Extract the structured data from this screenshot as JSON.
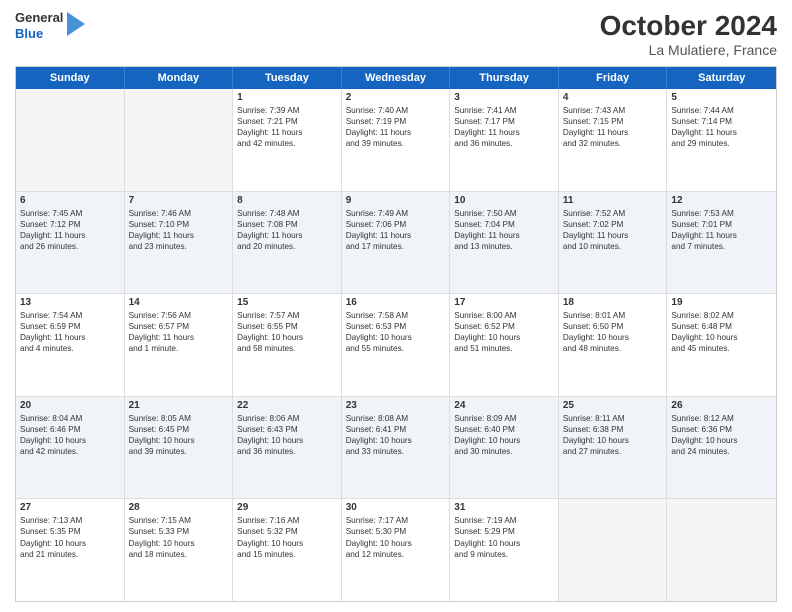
{
  "header": {
    "logo_general": "General",
    "logo_blue": "Blue",
    "title": "October 2024",
    "subtitle": "La Mulatiere, France"
  },
  "days_of_week": [
    "Sunday",
    "Monday",
    "Tuesday",
    "Wednesday",
    "Thursday",
    "Friday",
    "Saturday"
  ],
  "rows": [
    {
      "alt": false,
      "cells": [
        {
          "day": "",
          "empty": true,
          "lines": []
        },
        {
          "day": "",
          "empty": true,
          "lines": []
        },
        {
          "day": "1",
          "empty": false,
          "lines": [
            "Sunrise: 7:39 AM",
            "Sunset: 7:21 PM",
            "Daylight: 11 hours",
            "and 42 minutes."
          ]
        },
        {
          "day": "2",
          "empty": false,
          "lines": [
            "Sunrise: 7:40 AM",
            "Sunset: 7:19 PM",
            "Daylight: 11 hours",
            "and 39 minutes."
          ]
        },
        {
          "day": "3",
          "empty": false,
          "lines": [
            "Sunrise: 7:41 AM",
            "Sunset: 7:17 PM",
            "Daylight: 11 hours",
            "and 36 minutes."
          ]
        },
        {
          "day": "4",
          "empty": false,
          "lines": [
            "Sunrise: 7:43 AM",
            "Sunset: 7:15 PM",
            "Daylight: 11 hours",
            "and 32 minutes."
          ]
        },
        {
          "day": "5",
          "empty": false,
          "lines": [
            "Sunrise: 7:44 AM",
            "Sunset: 7:14 PM",
            "Daylight: 11 hours",
            "and 29 minutes."
          ]
        }
      ]
    },
    {
      "alt": true,
      "cells": [
        {
          "day": "6",
          "empty": false,
          "lines": [
            "Sunrise: 7:45 AM",
            "Sunset: 7:12 PM",
            "Daylight: 11 hours",
            "and 26 minutes."
          ]
        },
        {
          "day": "7",
          "empty": false,
          "lines": [
            "Sunrise: 7:46 AM",
            "Sunset: 7:10 PM",
            "Daylight: 11 hours",
            "and 23 minutes."
          ]
        },
        {
          "day": "8",
          "empty": false,
          "lines": [
            "Sunrise: 7:48 AM",
            "Sunset: 7:08 PM",
            "Daylight: 11 hours",
            "and 20 minutes."
          ]
        },
        {
          "day": "9",
          "empty": false,
          "lines": [
            "Sunrise: 7:49 AM",
            "Sunset: 7:06 PM",
            "Daylight: 11 hours",
            "and 17 minutes."
          ]
        },
        {
          "day": "10",
          "empty": false,
          "lines": [
            "Sunrise: 7:50 AM",
            "Sunset: 7:04 PM",
            "Daylight: 11 hours",
            "and 13 minutes."
          ]
        },
        {
          "day": "11",
          "empty": false,
          "lines": [
            "Sunrise: 7:52 AM",
            "Sunset: 7:02 PM",
            "Daylight: 11 hours",
            "and 10 minutes."
          ]
        },
        {
          "day": "12",
          "empty": false,
          "lines": [
            "Sunrise: 7:53 AM",
            "Sunset: 7:01 PM",
            "Daylight: 11 hours",
            "and 7 minutes."
          ]
        }
      ]
    },
    {
      "alt": false,
      "cells": [
        {
          "day": "13",
          "empty": false,
          "lines": [
            "Sunrise: 7:54 AM",
            "Sunset: 6:59 PM",
            "Daylight: 11 hours",
            "and 4 minutes."
          ]
        },
        {
          "day": "14",
          "empty": false,
          "lines": [
            "Sunrise: 7:56 AM",
            "Sunset: 6:57 PM",
            "Daylight: 11 hours",
            "and 1 minute."
          ]
        },
        {
          "day": "15",
          "empty": false,
          "lines": [
            "Sunrise: 7:57 AM",
            "Sunset: 6:55 PM",
            "Daylight: 10 hours",
            "and 58 minutes."
          ]
        },
        {
          "day": "16",
          "empty": false,
          "lines": [
            "Sunrise: 7:58 AM",
            "Sunset: 6:53 PM",
            "Daylight: 10 hours",
            "and 55 minutes."
          ]
        },
        {
          "day": "17",
          "empty": false,
          "lines": [
            "Sunrise: 8:00 AM",
            "Sunset: 6:52 PM",
            "Daylight: 10 hours",
            "and 51 minutes."
          ]
        },
        {
          "day": "18",
          "empty": false,
          "lines": [
            "Sunrise: 8:01 AM",
            "Sunset: 6:50 PM",
            "Daylight: 10 hours",
            "and 48 minutes."
          ]
        },
        {
          "day": "19",
          "empty": false,
          "lines": [
            "Sunrise: 8:02 AM",
            "Sunset: 6:48 PM",
            "Daylight: 10 hours",
            "and 45 minutes."
          ]
        }
      ]
    },
    {
      "alt": true,
      "cells": [
        {
          "day": "20",
          "empty": false,
          "lines": [
            "Sunrise: 8:04 AM",
            "Sunset: 6:46 PM",
            "Daylight: 10 hours",
            "and 42 minutes."
          ]
        },
        {
          "day": "21",
          "empty": false,
          "lines": [
            "Sunrise: 8:05 AM",
            "Sunset: 6:45 PM",
            "Daylight: 10 hours",
            "and 39 minutes."
          ]
        },
        {
          "day": "22",
          "empty": false,
          "lines": [
            "Sunrise: 8:06 AM",
            "Sunset: 6:43 PM",
            "Daylight: 10 hours",
            "and 36 minutes."
          ]
        },
        {
          "day": "23",
          "empty": false,
          "lines": [
            "Sunrise: 8:08 AM",
            "Sunset: 6:41 PM",
            "Daylight: 10 hours",
            "and 33 minutes."
          ]
        },
        {
          "day": "24",
          "empty": false,
          "lines": [
            "Sunrise: 8:09 AM",
            "Sunset: 6:40 PM",
            "Daylight: 10 hours",
            "and 30 minutes."
          ]
        },
        {
          "day": "25",
          "empty": false,
          "lines": [
            "Sunrise: 8:11 AM",
            "Sunset: 6:38 PM",
            "Daylight: 10 hours",
            "and 27 minutes."
          ]
        },
        {
          "day": "26",
          "empty": false,
          "lines": [
            "Sunrise: 8:12 AM",
            "Sunset: 6:36 PM",
            "Daylight: 10 hours",
            "and 24 minutes."
          ]
        }
      ]
    },
    {
      "alt": false,
      "cells": [
        {
          "day": "27",
          "empty": false,
          "lines": [
            "Sunrise: 7:13 AM",
            "Sunset: 5:35 PM",
            "Daylight: 10 hours",
            "and 21 minutes."
          ]
        },
        {
          "day": "28",
          "empty": false,
          "lines": [
            "Sunrise: 7:15 AM",
            "Sunset: 5:33 PM",
            "Daylight: 10 hours",
            "and 18 minutes."
          ]
        },
        {
          "day": "29",
          "empty": false,
          "lines": [
            "Sunrise: 7:16 AM",
            "Sunset: 5:32 PM",
            "Daylight: 10 hours",
            "and 15 minutes."
          ]
        },
        {
          "day": "30",
          "empty": false,
          "lines": [
            "Sunrise: 7:17 AM",
            "Sunset: 5:30 PM",
            "Daylight: 10 hours",
            "and 12 minutes."
          ]
        },
        {
          "day": "31",
          "empty": false,
          "lines": [
            "Sunrise: 7:19 AM",
            "Sunset: 5:29 PM",
            "Daylight: 10 hours",
            "and 9 minutes."
          ]
        },
        {
          "day": "",
          "empty": true,
          "lines": []
        },
        {
          "day": "",
          "empty": true,
          "lines": []
        }
      ]
    }
  ]
}
